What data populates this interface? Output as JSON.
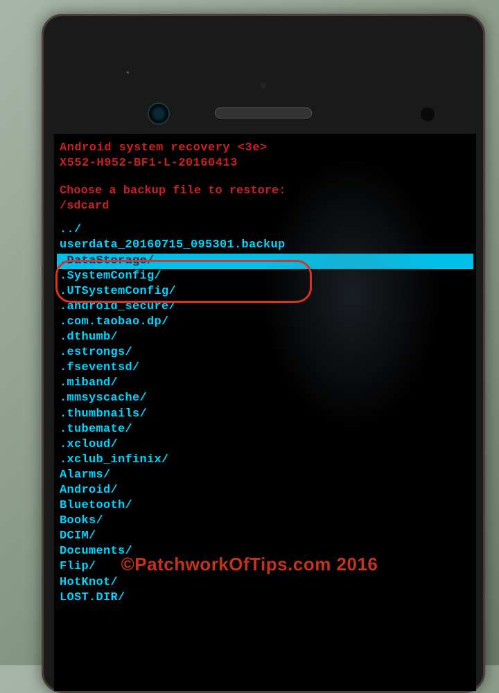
{
  "recovery": {
    "title": "Android system recovery <3e>",
    "build": "X552-H952-BF1-L-20160413",
    "prompt_line1": "Choose a backup file to restore:",
    "prompt_line2": "/sdcard"
  },
  "files": [
    {
      "name": "../",
      "selected": false
    },
    {
      "name": " userdata_20160715_095301.backup",
      "selected": false
    },
    {
      "name": ".DataStorage/",
      "selected": true
    },
    {
      "name": ".SystemConfig/",
      "selected": false
    },
    {
      "name": ".UTSystemConfig/",
      "selected": false
    },
    {
      "name": ".android_secure/",
      "selected": false
    },
    {
      "name": ".com.taobao.dp/",
      "selected": false
    },
    {
      "name": ".dthumb/",
      "selected": false
    },
    {
      "name": ".estrongs/",
      "selected": false
    },
    {
      "name": ".fseventsd/",
      "selected": false
    },
    {
      "name": ".miband/",
      "selected": false
    },
    {
      "name": ".mmsyscache/",
      "selected": false
    },
    {
      "name": ".thumbnails/",
      "selected": false
    },
    {
      "name": ".tubemate/",
      "selected": false
    },
    {
      "name": ".xcloud/",
      "selected": false
    },
    {
      "name": ".xclub_infinix/",
      "selected": false
    },
    {
      "name": "Alarms/",
      "selected": false
    },
    {
      "name": "Android/",
      "selected": false
    },
    {
      "name": "Bluetooth/",
      "selected": false
    },
    {
      "name": "Books/",
      "selected": false
    },
    {
      "name": "DCIM/",
      "selected": false
    },
    {
      "name": "Documents/",
      "selected": false
    },
    {
      "name": "Flip/",
      "selected": false
    },
    {
      "name": "HotKnot/",
      "selected": false
    },
    {
      "name": "LOST.DIR/",
      "selected": false
    }
  ],
  "watermark": "©PatchworkOfTips.com 2016"
}
